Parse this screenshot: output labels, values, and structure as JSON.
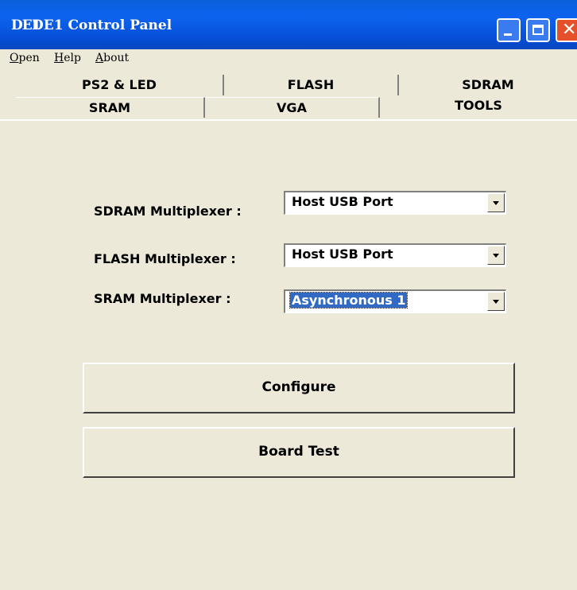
{
  "window": {
    "title": "DE1 Control Panel",
    "app_icon_text": "DE1"
  },
  "menu": [
    {
      "label": "Open",
      "accel": "O",
      "rest": "pen"
    },
    {
      "label": "Help",
      "accel": "H",
      "rest": "elp"
    },
    {
      "label": "About",
      "accel": "A",
      "rest": "bout"
    }
  ],
  "tabs": {
    "back_row": [
      "PS2 & LED",
      "FLASH",
      "SDRAM"
    ],
    "front_row": [
      "SRAM",
      "VGA",
      "TOOLS"
    ],
    "selected": "TOOLS"
  },
  "fields": {
    "sdram": {
      "label": "SDRAM Multiplexer :",
      "value": "Host USB Port"
    },
    "flash": {
      "label": "FLASH Multiplexer :",
      "value": "Host USB Port"
    },
    "sram": {
      "label": "SRAM Multiplexer :",
      "value": "Asynchronous 1"
    }
  },
  "buttons": {
    "configure": "Configure",
    "board_test": "Board Test"
  },
  "colors": {
    "titlebar": "#0d63ef",
    "panel_bg": "#ece9d8",
    "selection": "#316ac5",
    "close_button": "#e3502a"
  }
}
